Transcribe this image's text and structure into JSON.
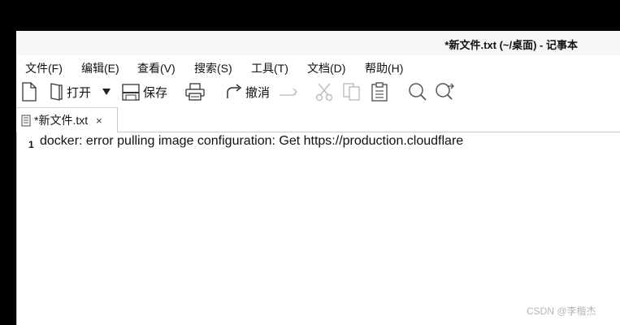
{
  "window": {
    "title": "*新文件.txt (~/桌面) - 记事本"
  },
  "menubar": {
    "items": [
      "文件(F)",
      "编辑(E)",
      "查看(V)",
      "搜索(S)",
      "工具(T)",
      "文档(D)",
      "帮助(H)"
    ]
  },
  "toolbar": {
    "new_icon": "new-document-icon",
    "open_label": "打开",
    "save_label": "保存",
    "print_icon": "print-icon",
    "undo_label": "撤消",
    "redo_icon": "redo-icon",
    "cut_icon": "cut-icon",
    "copy_icon": "copy-icon",
    "paste_icon": "paste-icon",
    "find_icon": "search-icon",
    "replace_icon": "find-replace-icon"
  },
  "tabs": [
    {
      "label": "*新文件.txt",
      "close": "×"
    }
  ],
  "editor": {
    "lines": [
      {
        "number": "1",
        "text": "docker: error pulling image configuration: Get https://production.cloudflare"
      }
    ]
  },
  "watermark": "CSDN @李楷杰"
}
